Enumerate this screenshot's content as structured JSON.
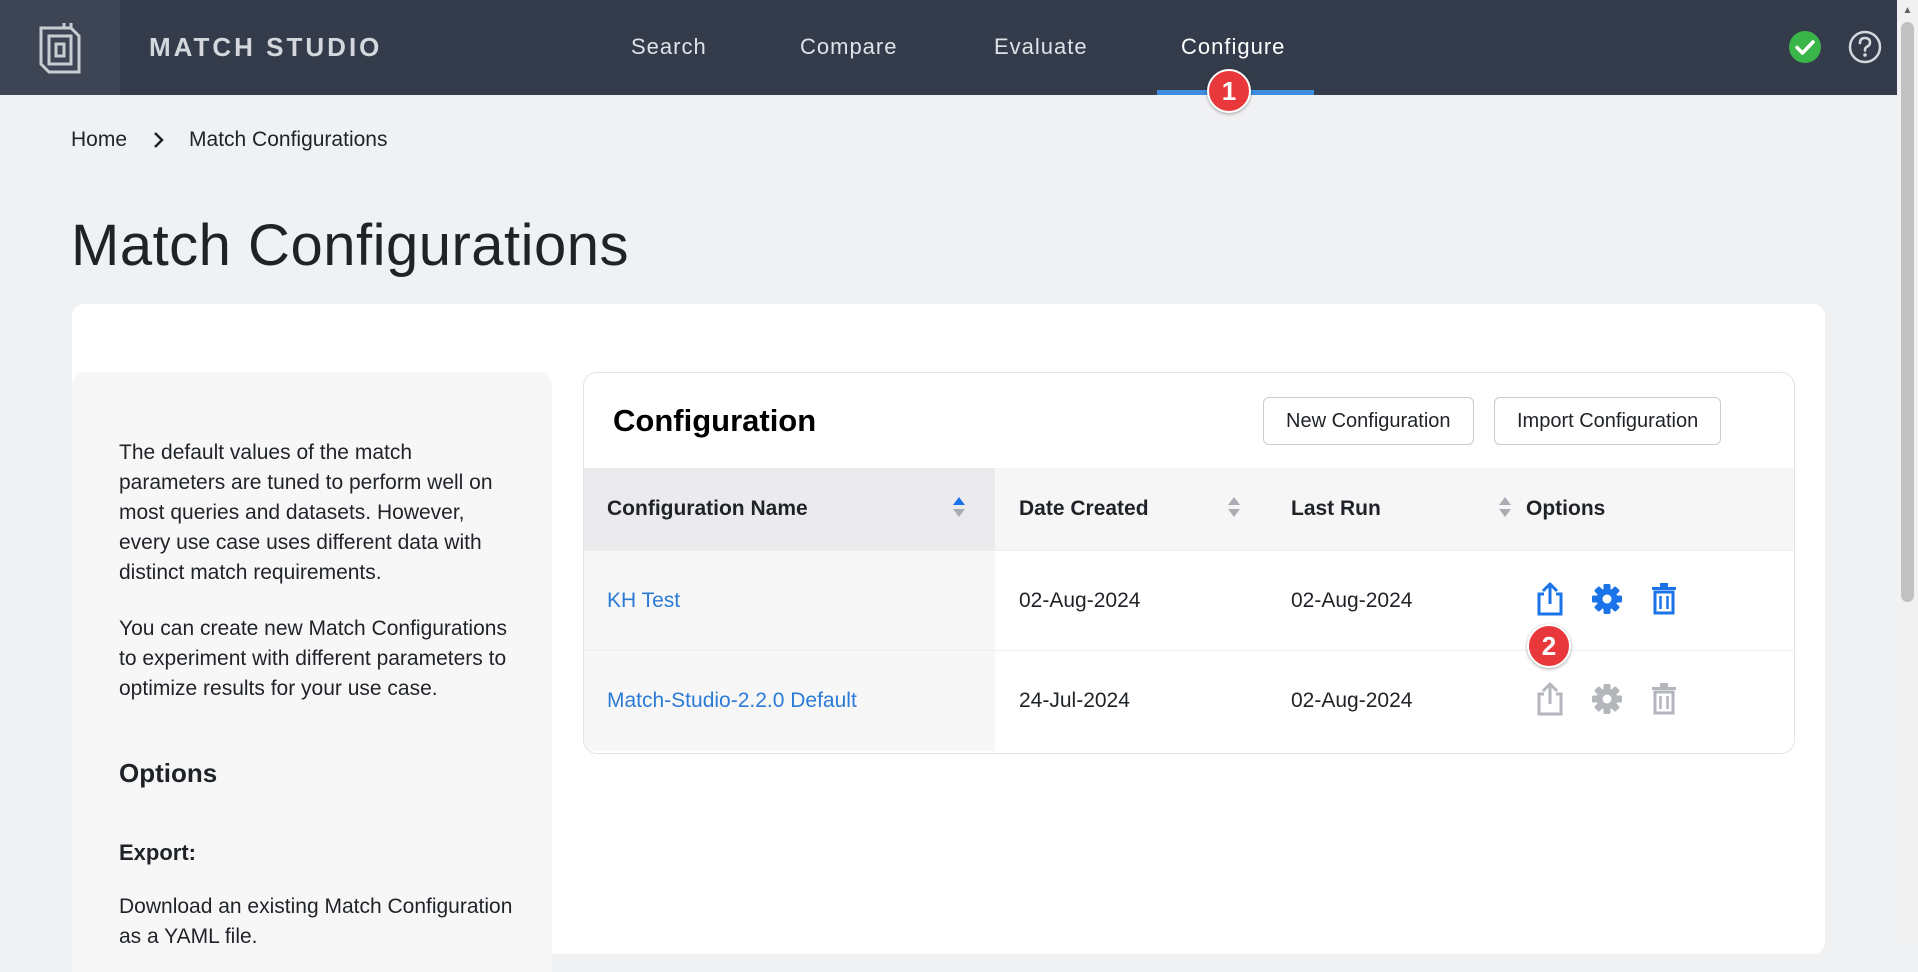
{
  "header": {
    "brand": "MATCH STUDIO",
    "logo_icon": "match-studio-logo-icon",
    "nav": [
      {
        "label": "Search",
        "active": false
      },
      {
        "label": "Compare",
        "active": false
      },
      {
        "label": "Evaluate",
        "active": false
      },
      {
        "label": "Configure",
        "active": true
      }
    ],
    "status_icon": "check-circle-icon",
    "help_icon": "question-circle-icon"
  },
  "annotations": {
    "marker_1": "1",
    "marker_2": "2"
  },
  "breadcrumb": {
    "home": "Home",
    "current": "Match Configurations"
  },
  "page": {
    "title": "Match Configurations"
  },
  "side_panel": {
    "paragraph_1": "The default values of the match parameters are tuned to perform well on most queries and datasets. However, every use case uses different data with distinct match requirements.",
    "paragraph_2": "You can create new Match Configurations to experiment with different parameters to optimize results for your use case.",
    "options_heading": "Options",
    "export_heading": "Export:",
    "export_text": "Download an existing Match Configuration as a YAML file."
  },
  "config": {
    "title": "Configuration",
    "new_button": "New Configuration",
    "import_button": "Import Configuration",
    "columns": {
      "name": "Configuration Name",
      "date_created": "Date Created",
      "last_run": "Last Run",
      "options": "Options"
    },
    "rows": [
      {
        "name": "KH Test",
        "date_created": "02-Aug-2024",
        "last_run": "02-Aug-2024",
        "options_enabled": true
      },
      {
        "name": "Match-Studio-2.2.0 Default",
        "date_created": "24-Jul-2024",
        "last_run": "02-Aug-2024",
        "options_enabled": false
      }
    ]
  },
  "colors": {
    "topbar": "#343c4b",
    "accent": "#3d8ee0",
    "link": "#2b7bd6",
    "icon_active": "#1a73e8",
    "icon_disabled": "#b3b6bb",
    "status_ok": "#3ab54a",
    "marker": "#e8383b"
  }
}
